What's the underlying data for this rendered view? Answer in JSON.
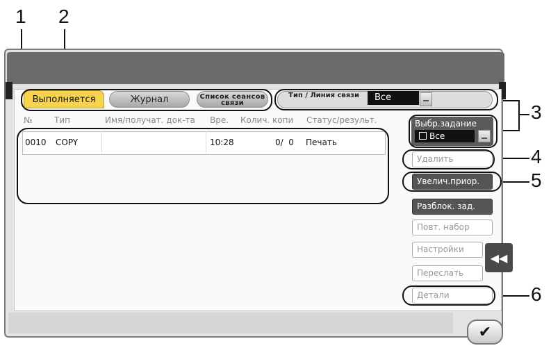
{
  "callouts": [
    "1",
    "2",
    "3",
    "4",
    "5",
    "6"
  ],
  "tabs": {
    "running": "Выполняется",
    "log": "Журнал",
    "sessions": "Список сеансов связи"
  },
  "filter": {
    "label": "Тип / Линия связи",
    "value": "Все"
  },
  "columns": [
    "№",
    "Тип",
    "Имя/получат. док-та",
    "Вре.",
    "Колич. копи",
    "Статус/результ."
  ],
  "rows": [
    {
      "no": "0010",
      "type": "COPY",
      "name": "",
      "time": "10:28",
      "count": "0/  0",
      "status": "Печать"
    }
  ],
  "sidebar": {
    "select_label": "Выбр.задание",
    "select_value": "Все",
    "delete": "Удалить",
    "raise_priority": "Увелич.приор.",
    "release": "Разблок. зад.",
    "redial": "Повт. набор",
    "settings": "Настройки",
    "forward": "Переслать",
    "details": "Детали"
  },
  "icons": {
    "collapse": "double-chevron-left-icon",
    "ok": "checkmark-icon",
    "select": "job-stack-icon"
  },
  "colors": {
    "active_tab": "#f6d24f",
    "dark_button": "#555555"
  }
}
